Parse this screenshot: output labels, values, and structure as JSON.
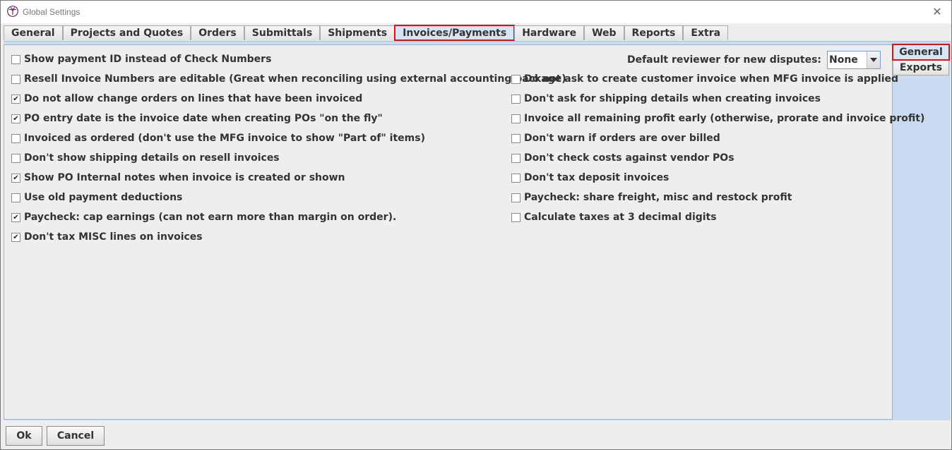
{
  "window": {
    "title": "Global Settings",
    "close_glyph": "✕",
    "app_icon": "palm-tree-logo"
  },
  "tabs": [
    {
      "label": "General",
      "active": false
    },
    {
      "label": "Projects and Quotes",
      "active": false
    },
    {
      "label": "Orders",
      "active": false
    },
    {
      "label": "Submittals",
      "active": false
    },
    {
      "label": "Shipments",
      "active": false
    },
    {
      "label": "Invoices/Payments",
      "active": true
    },
    {
      "label": "Hardware",
      "active": false
    },
    {
      "label": "Web",
      "active": false
    },
    {
      "label": "Reports",
      "active": false
    },
    {
      "label": "Extra",
      "active": false
    }
  ],
  "side_tabs": [
    {
      "label": "General",
      "active": true
    },
    {
      "label": "Exports",
      "active": false
    }
  ],
  "reviewer": {
    "label": "Default reviewer for new disputes:",
    "value": "None",
    "arrow": "▼"
  },
  "left_options": [
    {
      "label": "Show payment ID instead of Check Numbers",
      "checked": false
    },
    {
      "label": "Resell Invoice Numbers are editable (Great when reconciling using external accounting package)",
      "checked": false
    },
    {
      "label": "Do not allow change orders on lines that have been invoiced",
      "checked": true
    },
    {
      "label": "PO entry date is the invoice date when creating POs \"on the fly\"",
      "checked": true
    },
    {
      "label": "Invoiced as ordered (don't use the MFG invoice to show \"Part of\" items)",
      "checked": false
    },
    {
      "label": "Don't show shipping details on resell invoices",
      "checked": false
    },
    {
      "label": "Show PO Internal notes when invoice is created or shown",
      "checked": true
    },
    {
      "label": "Use old payment deductions",
      "checked": false
    },
    {
      "label": "Paycheck: cap earnings (can not earn more than margin on order).",
      "checked": true
    },
    {
      "label": "Don't tax MISC lines on invoices",
      "checked": true
    }
  ],
  "right_options": [
    {
      "label": "Do not ask to create customer invoice when MFG invoice is applied",
      "checked": false
    },
    {
      "label": "Don't ask for shipping details when creating invoices",
      "checked": false
    },
    {
      "label": "Invoice all remaining profit early (otherwise, prorate and invoice profit)",
      "checked": false
    },
    {
      "label": "Don't warn if orders are over billed",
      "checked": false
    },
    {
      "label": "Don't check costs against vendor POs",
      "checked": false
    },
    {
      "label": "Don't tax deposit invoices",
      "checked": false
    },
    {
      "label": "Paycheck: share freight, misc and restock profit",
      "checked": false
    },
    {
      "label": "Calculate taxes at 3 decimal digits",
      "checked": false
    }
  ],
  "check_glyph": "✔",
  "buttons": {
    "ok": "Ok",
    "cancel": "Cancel"
  },
  "colors": {
    "highlight": "#e01010",
    "content_bg": "#c9dbf0"
  }
}
